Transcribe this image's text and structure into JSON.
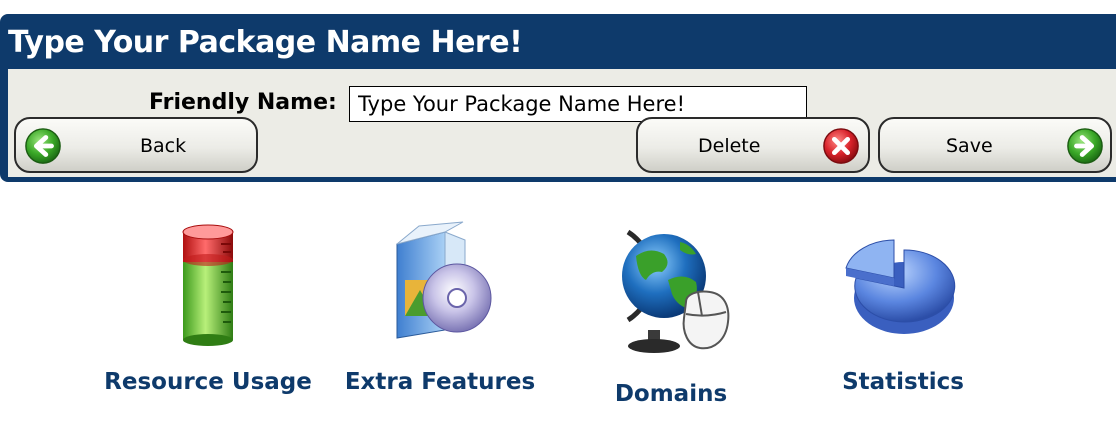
{
  "header": {
    "title": "Type Your Package Name Here!"
  },
  "form": {
    "friendly_name_label": "Friendly Name:",
    "friendly_name_value": "Type Your Package Name Here!"
  },
  "toolbar": {
    "back_label": "Back",
    "delete_label": "Delete",
    "save_label": "Save"
  },
  "features": {
    "resource_usage": {
      "label": "Resource Usage",
      "icon": "resource-usage-icon"
    },
    "extra_features": {
      "label": "Extra Features",
      "icon": "extra-features-icon"
    },
    "domains": {
      "label": "Domains",
      "icon": "domains-icon"
    },
    "statistics": {
      "label": "Statistics",
      "icon": "statistics-icon"
    }
  },
  "colors": {
    "header_bg": "#0e3a6b",
    "panel_bg": "#ecece6",
    "back_icon": "#3aa827",
    "save_icon": "#3aa827",
    "delete_icon": "#d8222a",
    "feature_label": "#0e3a6b"
  }
}
